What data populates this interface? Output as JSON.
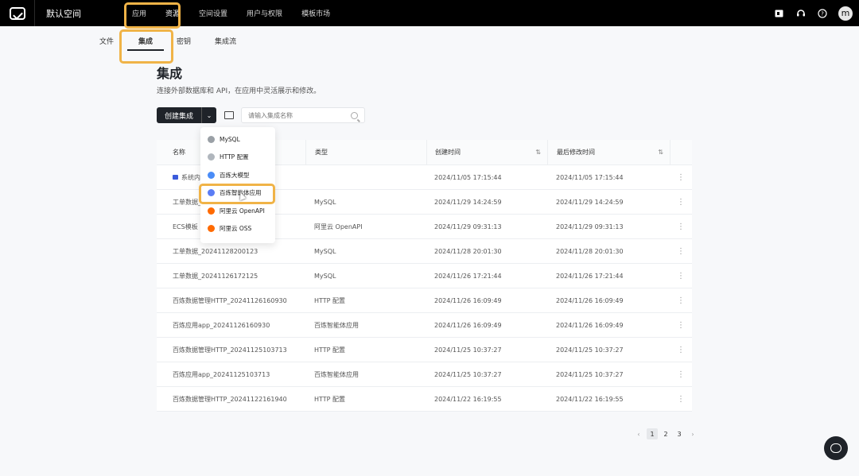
{
  "topbar": {
    "workspace": "默认空间",
    "nav": [
      "应用",
      "资源",
      "空间设置",
      "用户与权限",
      "模板市场"
    ],
    "avatar": "m",
    "icons": [
      "calendar-icon",
      "support-headset-icon",
      "help-icon"
    ]
  },
  "subtabs": [
    "文件",
    "集成",
    "密钥",
    "集成流"
  ],
  "page": {
    "title": "集成",
    "description": "连接外部数据库和 API，在应用中灵活展示和修改。"
  },
  "toolbar": {
    "create_label": "创建集成",
    "search_placeholder": "请输入集成名称"
  },
  "table": {
    "headers": {
      "name": "名称",
      "type": "类型",
      "created": "创建时间",
      "modified": "最后修改时间"
    },
    "rows": [
      {
        "name": "系统内",
        "type": "",
        "created": "2024/11/05 17:15:44",
        "modified": "2024/11/05 17:15:44",
        "folder": true
      },
      {
        "name": "工单数据_",
        "type": "MySQL",
        "created": "2024/11/29 14:24:59",
        "modified": "2024/11/29 14:24:59"
      },
      {
        "name": "ECS模板",
        "type": "阿里云 OpenAPI",
        "created": "2024/11/29 09:31:13",
        "modified": "2024/11/29 09:31:13"
      },
      {
        "name": "工单数据_20241128200123",
        "type": "MySQL",
        "created": "2024/11/28 20:01:30",
        "modified": "2024/11/28 20:01:30"
      },
      {
        "name": "工单数据_20241126172125",
        "type": "MySQL",
        "created": "2024/11/26 17:21:44",
        "modified": "2024/11/26 17:21:44"
      },
      {
        "name": "百炼数据管理HTTP_20241126160930",
        "type": "HTTP 配置",
        "created": "2024/11/26 16:09:49",
        "modified": "2024/11/26 16:09:49"
      },
      {
        "name": "百炼应用app_20241126160930",
        "type": "百炼智能体应用",
        "created": "2024/11/26 16:09:49",
        "modified": "2024/11/26 16:09:49"
      },
      {
        "name": "百炼数据管理HTTP_20241125103713",
        "type": "HTTP 配置",
        "created": "2024/11/25 10:37:27",
        "modified": "2024/11/25 10:37:27"
      },
      {
        "name": "百炼应用app_20241125103713",
        "type": "百炼智能体应用",
        "created": "2024/11/25 10:37:27",
        "modified": "2024/11/25 10:37:27"
      },
      {
        "name": "百炼数据管理HTTP_20241122161940",
        "type": "HTTP 配置",
        "created": "2024/11/22 16:19:55",
        "modified": "2024/11/22 16:19:55"
      }
    ]
  },
  "pagination": {
    "pages": [
      "1",
      "2",
      "3"
    ],
    "current": "1"
  },
  "dropdown": {
    "items": [
      {
        "label": "MySQL",
        "icon": "mysql-icon",
        "color": "#9aa0a6"
      },
      {
        "label": "HTTP 配置",
        "icon": "http-icon",
        "color": "#b0b6bd"
      },
      {
        "label": "百炼大模型",
        "icon": "bailian-model-icon",
        "color": "#4a8cf7"
      },
      {
        "label": "百炼智能体应用",
        "icon": "bailian-agent-icon",
        "color": "#5b7df5"
      },
      {
        "label": "阿里云 OpenAPI",
        "icon": "aliyun-openapi-icon",
        "color": "#ff6a00"
      },
      {
        "label": "阿里云 OSS",
        "icon": "aliyun-oss-icon",
        "color": "#ff6a00"
      }
    ]
  },
  "colors": {
    "highlight": "#f0b347",
    "dark": "#1f2329"
  }
}
